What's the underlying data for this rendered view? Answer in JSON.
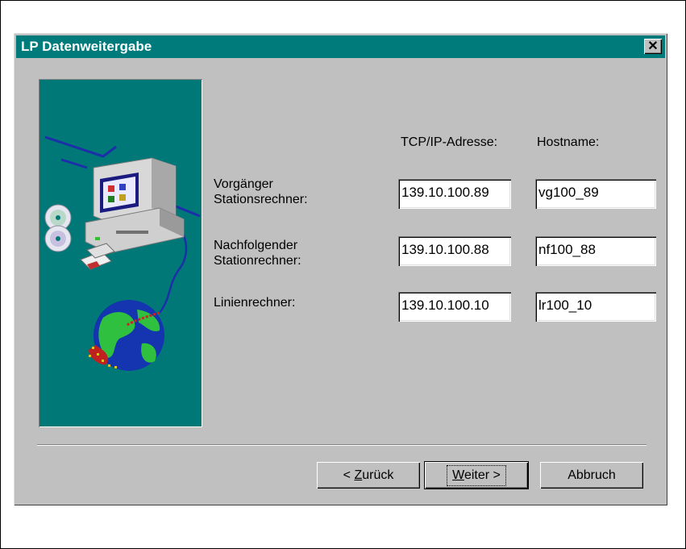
{
  "window": {
    "title": "LP Datenweitergabe",
    "close_glyph": "✕"
  },
  "columns": {
    "ip_header": "TCP/IP-Adresse:",
    "host_header": "Hostname:"
  },
  "rows": [
    {
      "label_line1": "Vorgänger",
      "label_line2": "Stationsrechner:",
      "ip": "139.10.100.89",
      "host": "vg100_89"
    },
    {
      "label_line1": "Nachfolgender",
      "label_line2": "Stationrechner:",
      "ip": "139.10.100.88",
      "host": "nf100_88"
    },
    {
      "label_line1": "Linienrechner:",
      "label_line2": "",
      "ip": "139.10.100.10",
      "host": "lr100_10"
    }
  ],
  "buttons": {
    "back_prefix": "< ",
    "back_mnemonic": "Z",
    "back_rest": "urück",
    "next_mnemonic": "W",
    "next_rest": "eiter >",
    "cancel": "Abbruch"
  },
  "colors": {
    "titlebar": "#007b7b",
    "panel": "#c0c0c0",
    "art_bg": "#007878"
  },
  "icons": {
    "art": "computer-network-globe-illustration",
    "close": "close-icon"
  }
}
